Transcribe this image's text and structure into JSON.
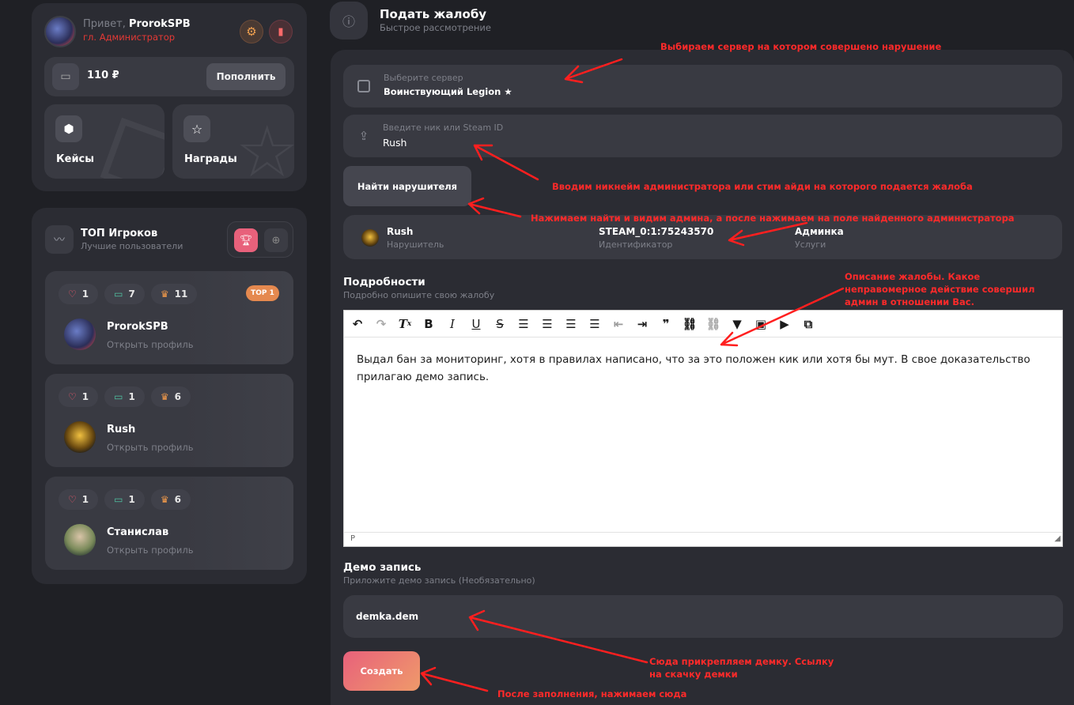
{
  "user": {
    "greeting": "Привет,",
    "name": "ProrokSPB",
    "role": "гл. Администратор",
    "balance": "110 ₽",
    "topup_label": "Пополнить"
  },
  "tiles": [
    {
      "label": "Кейсы",
      "icon": "box-icon"
    },
    {
      "label": "Награды",
      "icon": "star-icon"
    }
  ],
  "top": {
    "title": "ТОП Игроков",
    "subtitle": "Лучшие пользователи",
    "players": [
      {
        "name": "ProrokSPB",
        "link": "Открыть профиль",
        "likes": "1",
        "comments": "7",
        "trophies": "11",
        "badge": "TOP 1"
      },
      {
        "name": "Rush",
        "link": "Открыть профиль",
        "likes": "1",
        "comments": "1",
        "trophies": "6",
        "badge": ""
      },
      {
        "name": "Станислав",
        "link": "Открыть профиль",
        "likes": "1",
        "comments": "1",
        "trophies": "6",
        "badge": ""
      }
    ]
  },
  "complaint": {
    "title": "Подать жалобу",
    "subtitle": "Быстрое рассмотрение",
    "server_label": "Выберите сервер",
    "server_value": "Воинствующий Legion ★",
    "nick_label": "Введите ник или Steam ID",
    "nick_value": "Rush",
    "find_button": "Найти нарушителя",
    "found": {
      "name": "Rush",
      "name_sub": "Нарушитель",
      "steam": "STEAM_0:1:75243570",
      "steam_sub": "Идентификатор",
      "service": "Админка",
      "service_sub": "Услуги"
    },
    "details_title": "Подробности",
    "details_sub": "Подробно опишите свою жалобу",
    "editor_text": "Выдал бан за мониторинг, хотя в правилах написано, что за это положен кик или хотя бы мут. В свое доказательство прилагаю демо запись.",
    "editor_status": "P",
    "demo_title": "Демо запись",
    "demo_sub": "Приложите демо запись (Необязательно)",
    "demo_file": "demka.dem",
    "create_button": "Создать"
  },
  "toolbar_icons": [
    "undo-icon",
    "redo-icon",
    "clear-format-icon",
    "bold-icon",
    "italic-icon",
    "underline-icon",
    "strikethrough-icon",
    "align-left-icon",
    "align-center-icon",
    "align-right-icon",
    "align-justify-icon",
    "outdent-icon",
    "indent-icon",
    "quote-icon",
    "link-icon",
    "unlink-icon",
    "bookmark-icon",
    "image-icon",
    "media-icon",
    "embed-icon"
  ],
  "annotations": {
    "a1": "Выбираем сервер на котором совершено нарушение",
    "a2": "Вводим никнейм администратора или стим айди на которого подается жалоба",
    "a3": "Нажимаем найти и видим админа, а после нажимаем на поле найденного администратора",
    "a4": "Описание жалобы. Какое неправомерное действие совершил админ в отношении Вас.",
    "a5": "Сюда прикрепляем демку. Ссылку на скачку демки",
    "a6": "После заполнения, нажимаем сюда"
  },
  "colors": {
    "accent_orange": "#e5894f",
    "accent_pink": "#e8617b",
    "annotation_red": "#ff2a2a",
    "role_red": "#e53935"
  }
}
